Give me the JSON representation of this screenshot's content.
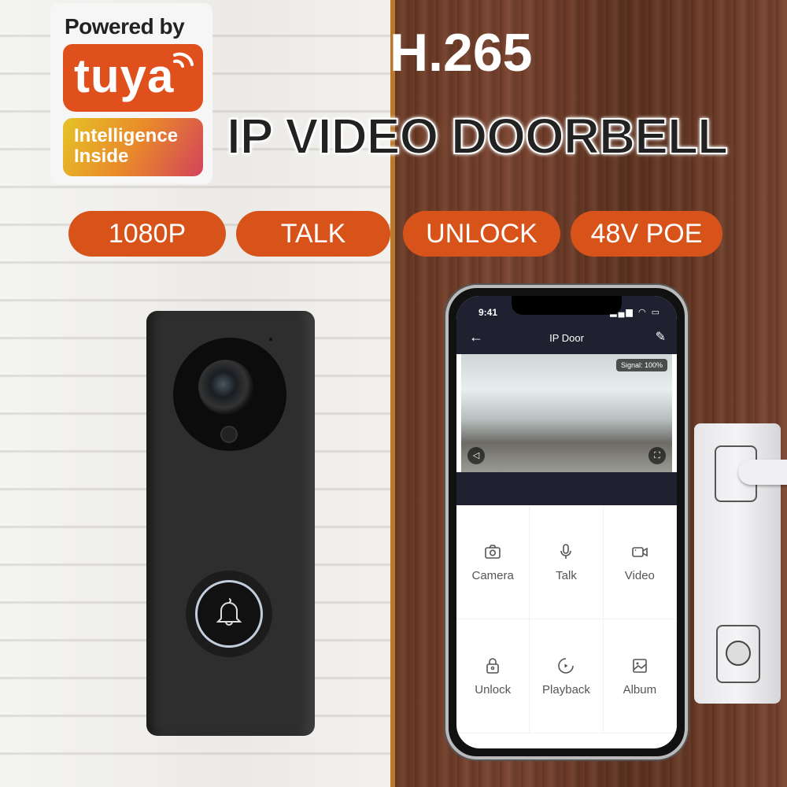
{
  "branding": {
    "powered_by": "Powered by",
    "brand_name": "tuya",
    "tagline_line1": "Intelligence",
    "tagline_line2": "Inside",
    "brand_color": "#e0501c"
  },
  "headline": {
    "codec": "H.265",
    "product": "IP VIDEO DOORBELL"
  },
  "features": [
    {
      "label": "1080P"
    },
    {
      "label": "TALK"
    },
    {
      "label": "UNLOCK"
    },
    {
      "label": "48V POE"
    }
  ],
  "feature_color": "#d8531a",
  "phone_app": {
    "status_time": "9:41",
    "screen_title": "IP Door",
    "signal_badge": "Signal: 100%",
    "actions": [
      {
        "label": "Camera",
        "icon": "camera-icon"
      },
      {
        "label": "Talk",
        "icon": "microphone-icon"
      },
      {
        "label": "Video",
        "icon": "video-camera-icon"
      },
      {
        "label": "Unlock",
        "icon": "lock-icon"
      },
      {
        "label": "Playback",
        "icon": "playback-icon"
      },
      {
        "label": "Album",
        "icon": "image-icon"
      }
    ]
  }
}
